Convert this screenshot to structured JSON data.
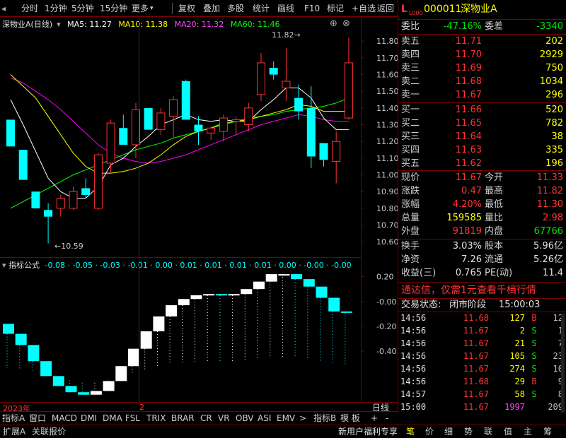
{
  "toolbar": {
    "items": [
      "分时",
      "1分钟",
      "5分钟",
      "15分钟",
      "更多",
      "复权",
      "叠加",
      "多股",
      "统计",
      "画线",
      "F10",
      "标记",
      "+自选",
      "返回"
    ]
  },
  "chart_header": {
    "stock_name": "深物业A(日线)",
    "ma5": "MA5: 11.27",
    "ma10": "MA10: 11.38",
    "ma20": "MA20: 11.32",
    "ma60": "MA60: 11.46"
  },
  "annotations": {
    "high": "11.82",
    "low": "10.59"
  },
  "indicator_header": {
    "label": "指标公式",
    "values": "-0.08 · -0.05 · -0.03 · -0.01 · 0.00 · 0.01 · 0.01 · 0.01 · 0.01 · 0.00 · -0.00 · -0.00"
  },
  "xaxis": {
    "year": "2023年",
    "marker": "2",
    "right_label": "日线"
  },
  "bottom_tabs": [
    "指标A",
    "窗口",
    "MACD",
    "DMI",
    "DMA",
    "FSL",
    "TRIX",
    "BRAR",
    "CR",
    "VR",
    "OBV",
    "ASI",
    "EMV",
    ">",
    "指标B",
    "模 板",
    "+",
    "-"
  ],
  "status": {
    "left": [
      "扩展A",
      "关联报价"
    ],
    "promo": "新用户福利专享",
    "right_tabs": [
      "笔",
      "价",
      "细",
      "势",
      "联",
      "值",
      "主",
      "筹"
    ]
  },
  "chart_data": {
    "type": "candlestick",
    "yaxis_main": {
      "ticks": [
        "11.80",
        "11.70",
        "11.60",
        "11.50",
        "11.40",
        "11.30",
        "11.20",
        "11.10",
        "11.00",
        "10.90",
        "10.80",
        "10.70",
        "10.60"
      ],
      "range": [
        10.55,
        11.86
      ]
    },
    "yaxis_indicator": {
      "ticks": [
        "0.20",
        "-0.00",
        "-0.20",
        "-0.40"
      ],
      "range": [
        -0.78,
        0.3
      ]
    },
    "candles": [
      {
        "o": 11.33,
        "h": 11.33,
        "l": 11.17,
        "c": 11.17
      },
      {
        "o": 11.15,
        "h": 11.15,
        "l": 10.97,
        "c": 10.97
      },
      {
        "o": 10.9,
        "h": 10.9,
        "l": 10.8,
        "c": 10.8
      },
      {
        "o": 10.79,
        "h": 10.83,
        "l": 10.59,
        "c": 10.75
      },
      {
        "o": 10.8,
        "h": 10.88,
        "l": 10.75,
        "c": 10.86
      },
      {
        "o": 10.8,
        "h": 10.93,
        "l": 10.79,
        "c": 10.9
      },
      {
        "o": 10.92,
        "h": 10.98,
        "l": 10.86,
        "c": 10.88
      },
      {
        "o": 10.8,
        "h": 11.13,
        "l": 10.79,
        "c": 11.12
      },
      {
        "o": 11.07,
        "h": 11.33,
        "l": 11.01,
        "c": 11.31
      },
      {
        "o": 11.28,
        "h": 11.36,
        "l": 11.18,
        "c": 11.18
      },
      {
        "o": 11.18,
        "h": 11.43,
        "l": 11.1,
        "c": 11.39
      },
      {
        "o": 11.4,
        "h": 11.4,
        "l": 11.27,
        "c": 11.27
      },
      {
        "o": 11.27,
        "h": 11.4,
        "l": 11.24,
        "c": 11.37
      },
      {
        "o": 11.35,
        "h": 11.47,
        "l": 11.22,
        "c": 11.45
      },
      {
        "o": 11.56,
        "h": 11.57,
        "l": 11.33,
        "c": 11.33
      },
      {
        "o": 11.3,
        "h": 11.35,
        "l": 11.18,
        "c": 11.26
      },
      {
        "o": 11.25,
        "h": 11.29,
        "l": 11.21,
        "c": 11.28
      },
      {
        "o": 11.26,
        "h": 11.36,
        "l": 11.2,
        "c": 11.34
      },
      {
        "o": 11.32,
        "h": 11.35,
        "l": 11.24,
        "c": 11.33
      },
      {
        "o": 11.3,
        "h": 11.43,
        "l": 11.26,
        "c": 11.4
      },
      {
        "o": 11.48,
        "h": 11.73,
        "l": 11.44,
        "c": 11.67
      },
      {
        "o": 11.64,
        "h": 11.68,
        "l": 11.57,
        "c": 11.6
      },
      {
        "o": 11.52,
        "h": 11.76,
        "l": 11.44,
        "c": 11.56
      },
      {
        "o": 11.46,
        "h": 11.54,
        "l": 11.33,
        "c": 11.38
      },
      {
        "o": 11.4,
        "h": 11.53,
        "l": 11.04,
        "c": 11.11
      },
      {
        "o": 11.19,
        "h": 11.19,
        "l": 11.05,
        "c": 11.09
      },
      {
        "o": 11.08,
        "h": 11.26,
        "l": 10.95,
        "c": 11.2
      },
      {
        "o": 11.34,
        "h": 11.82,
        "l": 11.33,
        "c": 11.67
      }
    ],
    "ma5": [
      11.45,
      11.3,
      11.14,
      10.98,
      10.9,
      10.86,
      10.86,
      10.93,
      11.06,
      11.1,
      11.17,
      11.23,
      11.3,
      11.33,
      11.36,
      11.33,
      11.32,
      11.33,
      11.32,
      11.32,
      11.39,
      11.45,
      11.52,
      11.52,
      11.46,
      11.34,
      11.27,
      11.27
    ],
    "ma10": [
      11.6,
      11.53,
      11.46,
      11.35,
      11.24,
      11.13,
      11.05,
      11.01,
      11.01,
      11.02,
      11.04,
      11.07,
      11.12,
      11.18,
      11.23,
      11.26,
      11.28,
      11.31,
      11.32,
      11.33,
      11.35,
      11.37,
      11.39,
      11.42,
      11.41,
      11.38,
      11.38,
      11.38
    ],
    "ma20": [
      11.58,
      11.55,
      11.5,
      11.45,
      11.39,
      11.32,
      11.25,
      11.18,
      11.13,
      11.1,
      11.08,
      11.07,
      11.08,
      11.1,
      11.12,
      11.15,
      11.18,
      11.21,
      11.24,
      11.27,
      11.3,
      11.32,
      11.34,
      11.36,
      11.35,
      11.33,
      11.32,
      11.32
    ],
    "ma60": [
      10.8,
      10.84,
      10.88,
      10.92,
      10.96,
      11.0,
      11.03,
      11.06,
      11.09,
      11.12,
      11.15,
      11.17,
      11.19,
      11.22,
      11.24,
      11.26,
      11.28,
      11.3,
      11.32,
      11.34,
      11.35,
      11.36,
      11.38,
      11.39,
      11.4,
      11.41,
      11.43,
      11.46
    ],
    "indicator": [
      {
        "a": -0.18,
        "b": -0.26,
        "c": "cyan"
      },
      {
        "a": -0.26,
        "b": -0.35,
        "c": "cyan"
      },
      {
        "a": -0.35,
        "b": -0.48,
        "c": "cyan"
      },
      {
        "a": -0.48,
        "b": -0.6,
        "c": "cyan"
      },
      {
        "a": -0.6,
        "b": -0.68,
        "c": "cyan"
      },
      {
        "a": -0.68,
        "b": -0.73,
        "c": "cyan"
      },
      {
        "a": -0.73,
        "b": -0.75,
        "c": "cyan"
      },
      {
        "a": -0.75,
        "b": -0.72,
        "c": "white"
      },
      {
        "a": -0.72,
        "b": -0.64,
        "c": "white"
      },
      {
        "a": -0.64,
        "b": -0.52,
        "c": "white"
      },
      {
        "a": -0.52,
        "b": -0.38,
        "c": "white"
      },
      {
        "a": -0.38,
        "b": -0.24,
        "c": "white"
      },
      {
        "a": -0.24,
        "b": -0.12,
        "c": "white"
      },
      {
        "a": -0.12,
        "b": -0.03,
        "c": "white"
      },
      {
        "a": -0.03,
        "b": 0.02,
        "c": "white"
      },
      {
        "a": 0.02,
        "b": 0.05,
        "c": "white"
      },
      {
        "a": 0.05,
        "b": 0.06,
        "c": "white"
      },
      {
        "a": 0.06,
        "b": 0.05,
        "c": "cyan"
      },
      {
        "a": 0.05,
        "b": 0.06,
        "c": "white"
      },
      {
        "a": 0.06,
        "b": 0.1,
        "c": "white"
      },
      {
        "a": 0.1,
        "b": 0.16,
        "c": "white"
      },
      {
        "a": 0.16,
        "b": 0.22,
        "c": "white"
      },
      {
        "a": 0.22,
        "b": 0.22,
        "c": "white"
      },
      {
        "a": 0.22,
        "b": 0.18,
        "c": "cyan"
      },
      {
        "a": 0.18,
        "b": 0.12,
        "c": "cyan"
      },
      {
        "a": 0.12,
        "b": 0.03,
        "c": "cyan"
      },
      {
        "a": 0.03,
        "b": -0.08,
        "c": "cyan"
      },
      {
        "a": -0.08,
        "b": -0.09,
        "c": "cyan"
      }
    ]
  },
  "quote": {
    "title_mark": "L",
    "title_sub": "L000",
    "code": "000011",
    "name": "深物业A",
    "weibi_label": "委比",
    "weibi": "-47.16%",
    "weicha_label": "委差",
    "weicha": "-3340",
    "sells": [
      {
        "label": "卖五",
        "price": "11.71",
        "vol": "202"
      },
      {
        "label": "卖四",
        "price": "11.70",
        "vol": "2929"
      },
      {
        "label": "卖三",
        "price": "11.69",
        "vol": "750"
      },
      {
        "label": "卖二",
        "price": "11.68",
        "vol": "1034"
      },
      {
        "label": "卖一",
        "price": "11.67",
        "vol": "296"
      }
    ],
    "buys": [
      {
        "label": "买一",
        "price": "11.66",
        "vol": "520"
      },
      {
        "label": "买二",
        "price": "11.65",
        "vol": "782"
      },
      {
        "label": "买三",
        "price": "11.64",
        "vol": "38"
      },
      {
        "label": "买四",
        "price": "11.63",
        "vol": "335"
      },
      {
        "label": "买五",
        "price": "11.62",
        "vol": "196"
      }
    ],
    "stats": [
      {
        "l1": "现价",
        "v1": "11.67",
        "c1": "red",
        "l2": "今开",
        "v2": "11.33",
        "c2": "red"
      },
      {
        "l1": "涨跌",
        "v1": "0.47",
        "c1": "red",
        "l2": "最高",
        "v2": "11.82",
        "c2": "red"
      },
      {
        "l1": "涨幅",
        "v1": "4.20%",
        "c1": "red",
        "l2": "最低",
        "v2": "11.30",
        "c2": "red"
      },
      {
        "l1": "总量",
        "v1": "159585",
        "c1": "yellow",
        "l2": "量比",
        "v2": "2.98",
        "c2": "red"
      },
      {
        "l1": "外盘",
        "v1": "91819",
        "c1": "red",
        "l2": "内盘",
        "v2": "67766",
        "c2": "green"
      }
    ],
    "stats2": [
      {
        "l1": "换手",
        "v1": "3.03%",
        "l2": "股本",
        "v2": "5.96亿"
      },
      {
        "l1": "净资",
        "v1": "7.26",
        "l2": "流通",
        "v2": "5.26亿"
      },
      {
        "l1": "收益(三)",
        "v1": "0.765",
        "l2": "PE(动)",
        "v2": "11.4"
      }
    ],
    "ad": "通达信，仅需1元查看千档行情",
    "trade_state_label": "交易状态:",
    "trade_state": "闭市阶段",
    "trade_time": "15:00:03",
    "trades": [
      {
        "t": "14:56",
        "p": "11.68",
        "v": "127",
        "bs": "B",
        "n": "12",
        "pc": "red",
        "bc": "red",
        "vc": "yellow"
      },
      {
        "t": "14:56",
        "p": "11.67",
        "v": "2",
        "bs": "S",
        "n": "1",
        "pc": "red",
        "bc": "green",
        "vc": "yellow"
      },
      {
        "t": "14:56",
        "p": "11.67",
        "v": "21",
        "bs": "S",
        "n": "7",
        "pc": "red",
        "bc": "green",
        "vc": "yellow"
      },
      {
        "t": "14:56",
        "p": "11.67",
        "v": "105",
        "bs": "S",
        "n": "23",
        "pc": "red",
        "bc": "green",
        "vc": "yellow"
      },
      {
        "t": "14:56",
        "p": "11.67",
        "v": "274",
        "bs": "S",
        "n": "10",
        "pc": "red",
        "bc": "green",
        "vc": "yellow"
      },
      {
        "t": "14:56",
        "p": "11.68",
        "v": "29",
        "bs": "B",
        "n": "9",
        "pc": "red",
        "bc": "red",
        "vc": "yellow"
      },
      {
        "t": "14:57",
        "p": "11.67",
        "v": "58",
        "bs": "S",
        "n": "8",
        "pc": "red",
        "bc": "green",
        "vc": "yellow"
      },
      {
        "t": "15:00",
        "p": "11.67",
        "v": "1997",
        "bs": "",
        "n": "209",
        "pc": "red",
        "bc": "white",
        "vc": "magenta"
      }
    ]
  },
  "colors": {
    "up": "#ff3333",
    "down": "#00ffff",
    "ma5": "#ffffff",
    "ma10": "#ffff00",
    "ma20": "#ff00ff",
    "ma60": "#00ff00",
    "border": "#7a0000"
  }
}
